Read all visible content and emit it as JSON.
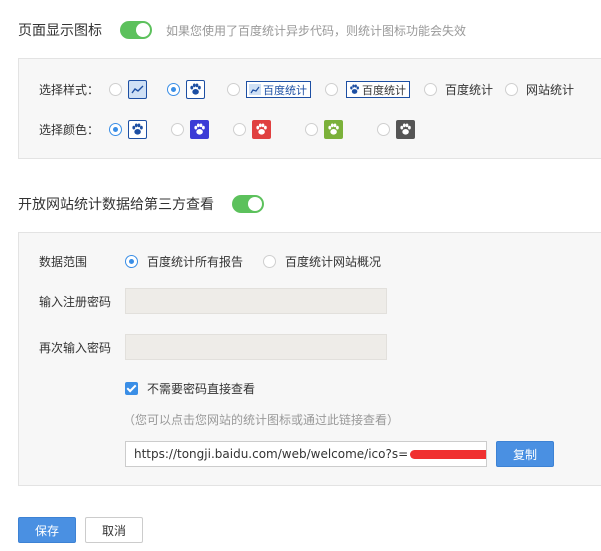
{
  "display_icon": {
    "label": "页面显示图标",
    "hint": "如果您使用了百度统计异步代码，则统计图标功能会失效",
    "style_label": "选择样式：",
    "style_options": [
      {
        "text": ""
      },
      {
        "text": ""
      },
      {
        "text": "百度统计"
      },
      {
        "text": "百度统计"
      },
      {
        "text": "百度统计"
      },
      {
        "text": "网站统计"
      }
    ],
    "color_label": "选择颜色：",
    "colors": [
      "#1d4fa3",
      "#3b3bd6",
      "#e04040",
      "#7bb13a",
      "#555555"
    ]
  },
  "share": {
    "label": "开放网站统计数据给第三方查看",
    "range_label": "数据范围",
    "range_all": "百度统计所有报告",
    "range_overview": "百度统计网站概况",
    "password_label": "输入注册密码",
    "password_again_label": "再次输入密码",
    "no_password": "不需要密码直接查看",
    "note": "（您可以点击您网站的统计图标或通过此链接查看）",
    "url": "https://tongji.baidu.com/web/welcome/ico?s=",
    "copy": "复制"
  },
  "actions": {
    "save": "保存",
    "cancel": "取消"
  }
}
